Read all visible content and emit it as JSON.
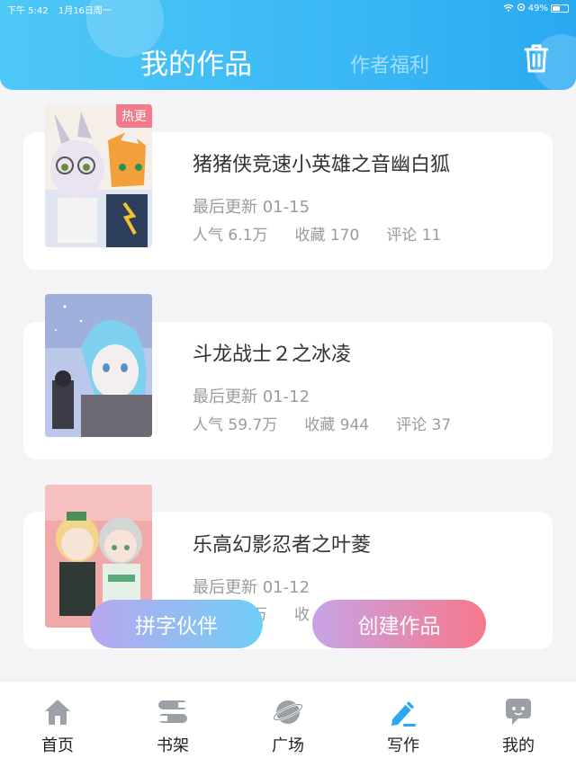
{
  "status_bar": {
    "time": "下午 5:42",
    "date": "1月16日周一",
    "battery": "49%",
    "battery_level": 0.49
  },
  "header": {
    "tab_active": "我的作品",
    "tab_inactive": "作者福利"
  },
  "colors": {
    "accent_blue": "#3ab8f5",
    "hot_badge": "#f27a8a",
    "active_nav": "#2aa9f1",
    "inactive_nav": "#9aa0a6"
  },
  "works": [
    {
      "title": "猪猪侠竞速小英雄之音幽白狐",
      "badge": "热更",
      "updated": "最后更新 01-15",
      "popularity": "人气 6.1万",
      "favorites": "收藏 170",
      "comments": "评论 11"
    },
    {
      "title": "斗龙战士２之冰凌",
      "updated": "最后更新 01-12",
      "popularity": "人气 59.7万",
      "favorites": "收藏 944",
      "comments": "评论 37"
    },
    {
      "title": "乐高幻影忍者之叶菱",
      "updated": "最后更新 01-12",
      "popularity_partial": "万",
      "favorites_partial": "收"
    }
  ],
  "buttons": {
    "partner": "拼字伙伴",
    "create": "创建作品"
  },
  "nav": [
    {
      "label": "首页",
      "icon": "home-icon"
    },
    {
      "label": "书架",
      "icon": "bookshelf-icon"
    },
    {
      "label": "广场",
      "icon": "planet-icon"
    },
    {
      "label": "写作",
      "icon": "pencil-icon",
      "active": true
    },
    {
      "label": "我的",
      "icon": "chat-bubble-icon"
    }
  ]
}
